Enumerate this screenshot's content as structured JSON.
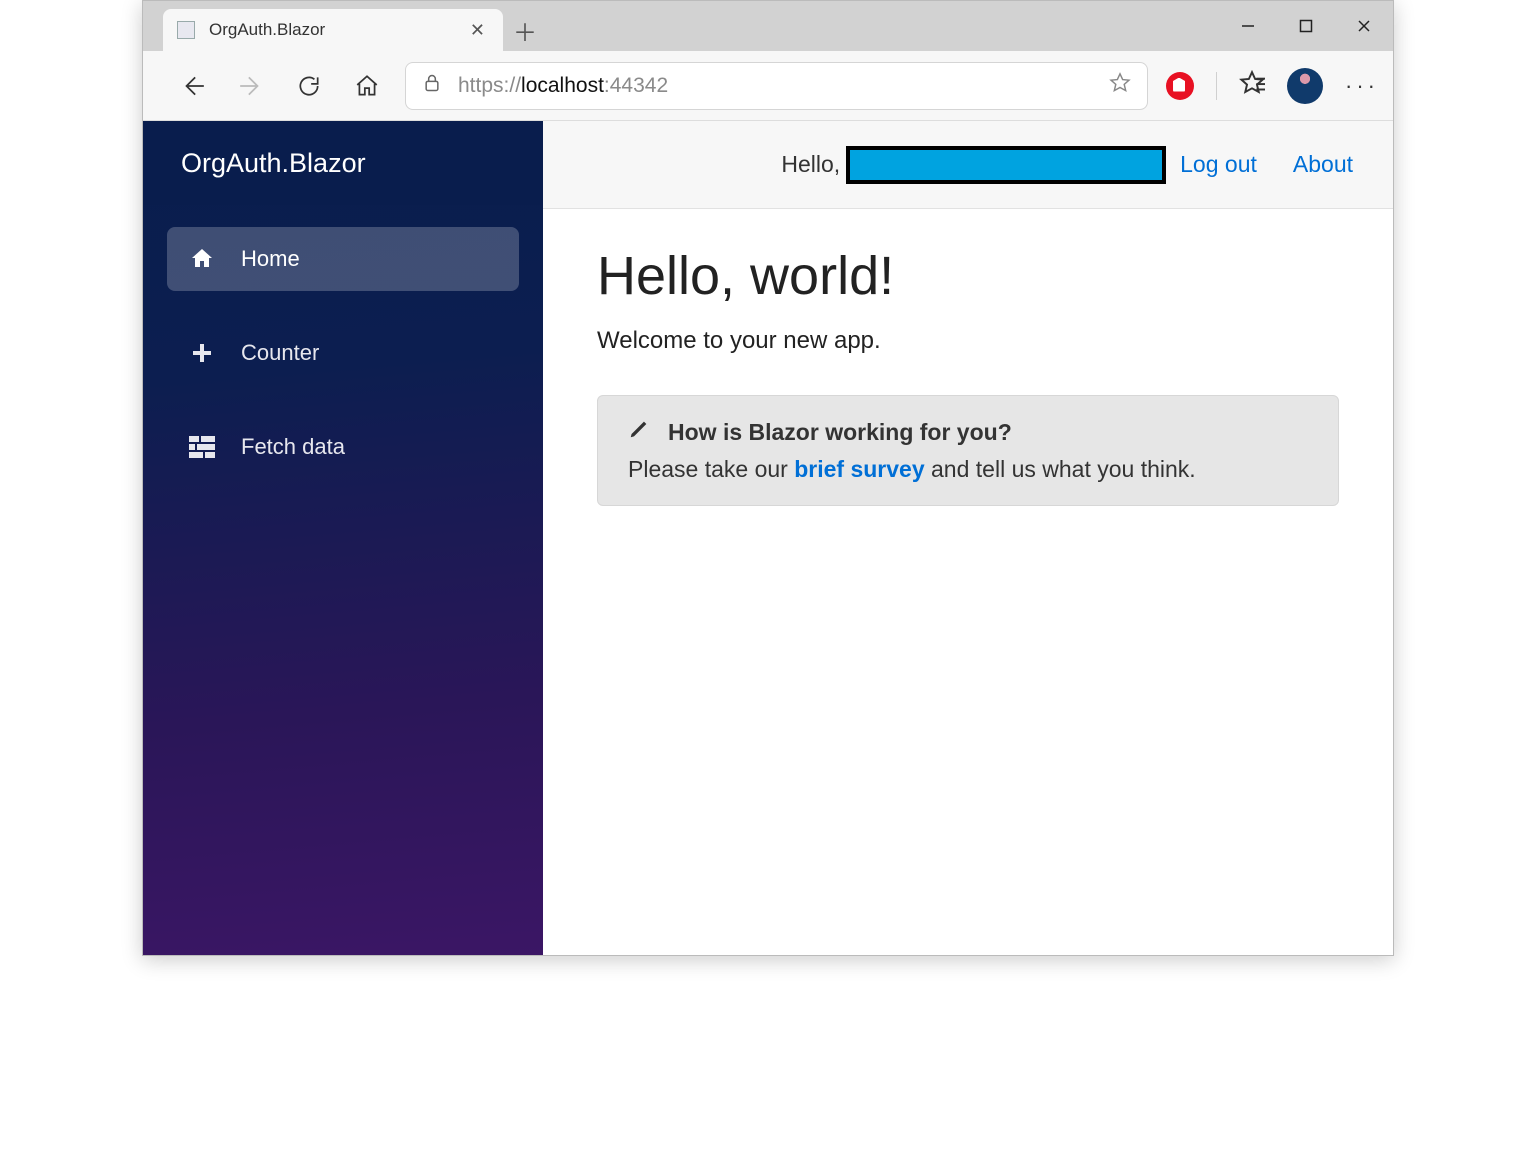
{
  "browser": {
    "tab_title": "OrgAuth.Blazor",
    "url_scheme": "https://",
    "url_host": "localhost",
    "url_port": ":44342"
  },
  "sidebar": {
    "brand": "OrgAuth.Blazor",
    "items": [
      {
        "label": "Home",
        "icon": "home",
        "active": true
      },
      {
        "label": "Counter",
        "icon": "plus",
        "active": false
      },
      {
        "label": "Fetch data",
        "icon": "list",
        "active": false
      }
    ]
  },
  "topbar": {
    "greeting": "Hello, ",
    "logout": "Log out",
    "about": "About"
  },
  "page": {
    "heading": "Hello, world!",
    "subtext": "Welcome to your new app."
  },
  "survey": {
    "title": "How is Blazor working for you?",
    "before_link": "Please take our ",
    "link": "brief survey",
    "after_link": " and tell us what you think."
  }
}
